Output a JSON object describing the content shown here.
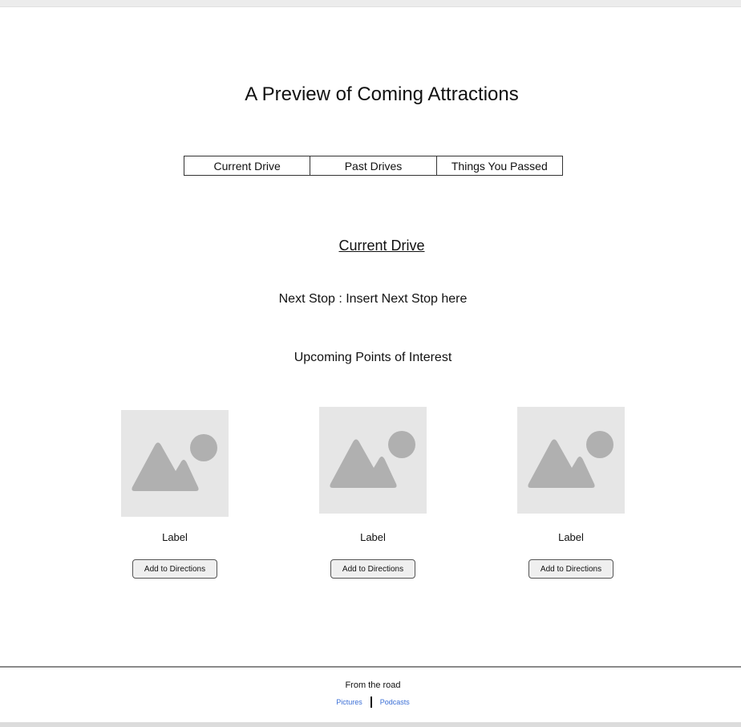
{
  "header": {
    "title": "A Preview of Coming Attractions"
  },
  "tabs": [
    {
      "label": "Current Drive"
    },
    {
      "label": "Past Drives"
    },
    {
      "label": "Things You Passed"
    }
  ],
  "current_drive": {
    "heading": "Current Drive",
    "next_stop": "Next Stop : Insert Next Stop here",
    "upcoming_heading": "Upcoming Points of Interest"
  },
  "points_of_interest": [
    {
      "label": "Label",
      "button": "Add to Directions",
      "image_icon": "image-placeholder-icon"
    },
    {
      "label": "Label",
      "button": "Add to Directions",
      "image_icon": "image-placeholder-icon"
    },
    {
      "label": "Label",
      "button": "Add to Directions",
      "image_icon": "image-placeholder-icon"
    }
  ],
  "footer": {
    "title": "From the road",
    "links": [
      {
        "label": "Pictures"
      },
      {
        "label": "Podcasts"
      }
    ]
  },
  "colors": {
    "placeholder_bg": "#e6e6e6",
    "placeholder_shape": "#b0b0b0",
    "link": "#3b6fd6"
  }
}
